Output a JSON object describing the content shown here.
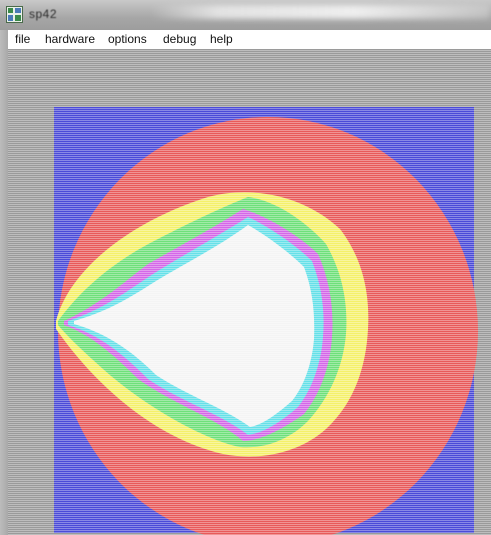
{
  "window": {
    "title": "sp42",
    "icon": "app-grid-icon"
  },
  "menu": {
    "items": [
      {
        "id": "file",
        "label": "file"
      },
      {
        "id": "hardware",
        "label": "hardware"
      },
      {
        "id": "options",
        "label": "options"
      },
      {
        "id": "debug",
        "label": "debug"
      },
      {
        "id": "help",
        "label": "help"
      }
    ]
  },
  "canvas": {
    "content": "fractal-render",
    "colors": {
      "outer": "#4b4bd8",
      "ring1": "#e85a5a",
      "ring2": "#f4f06a",
      "ring3": "#6ee07a",
      "ring4": "#d468e8",
      "ring5": "#66e0e8",
      "interior": "#f4f4f4",
      "background": "#9a9a9a"
    }
  }
}
